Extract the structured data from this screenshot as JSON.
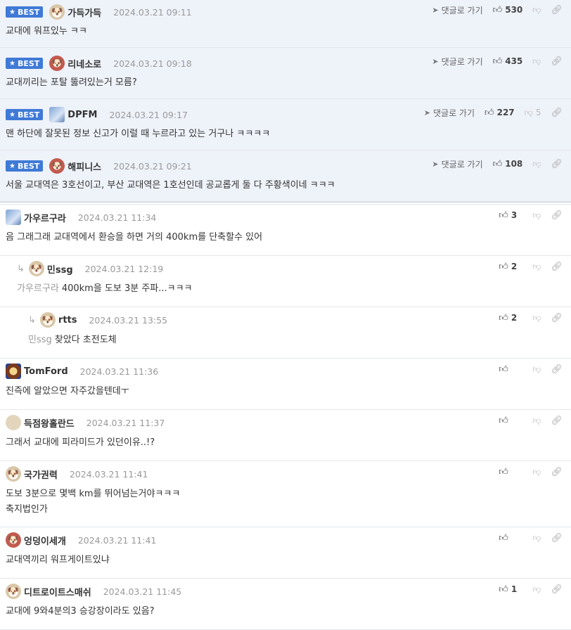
{
  "ui": {
    "best_label": "BEST",
    "goto_label": "댓글로 가기"
  },
  "comments": [
    {
      "nick": "가득가득",
      "date": "2024.03.21 09:11",
      "text": "교대에 워프있누 ㅋㅋ",
      "likes": "530",
      "dislikes": ""
    },
    {
      "nick": "리네소로",
      "date": "2024.03.21 09:18",
      "text": "교대끼리는 포탈 뚫려있는거 모름?",
      "likes": "435",
      "dislikes": ""
    },
    {
      "nick": "DPFM",
      "date": "2024.03.21 09:17",
      "text": "맨 하단에 잘못된 정보 신고가 이럴 때 누르라고 있는 거구나 ㅋㅋㅋㅋ",
      "likes": "227",
      "dislikes": "5"
    },
    {
      "nick": "해피니스",
      "date": "2024.03.21 09:21",
      "text": "서울 교대역은 3호선이고, 부산 교대역은 1호선인데 공교롭게 둘 다 주황색이네 ㅋㅋㅋ",
      "likes": "108",
      "dislikes": ""
    },
    {
      "nick": "가우르구라",
      "date": "2024.03.21 11:34",
      "text": "음 그래그래 교대역에서 환승을 하면 거의 400km를 단축할수 있어",
      "likes": "3",
      "dislikes": ""
    },
    {
      "nick": "민ssg",
      "date": "2024.03.21 12:19",
      "mention": "가우르구라",
      "text": "400km을 도보 3분 주파...ㅋㅋㅋ",
      "likes": "2",
      "dislikes": ""
    },
    {
      "nick": "rtts",
      "date": "2024.03.21 13:55",
      "mention": "민ssg",
      "text": "찾았다 초전도체",
      "likes": "2",
      "dislikes": ""
    },
    {
      "nick": "TomFord",
      "date": "2024.03.21 11:36",
      "text": "진즉에 알았으면 자주갔을텐데ㅜ",
      "likes": "",
      "dislikes": ""
    },
    {
      "nick": "득점왕홀란드",
      "date": "2024.03.21 11:37",
      "text": "그래서 교대에 피라미드가 있던이유..!?",
      "likes": "",
      "dislikes": ""
    },
    {
      "nick": "국가권력",
      "date": "2024.03.21 11:41",
      "text": "도보 3분으로 몇백 km를 뛰어넘는거야ㅋㅋㅋ",
      "text2": "축지법인가",
      "likes": "",
      "dislikes": ""
    },
    {
      "nick": "엉덩이세개",
      "date": "2024.03.21 11:41",
      "text": "교대역끼리 워프게이트있냐",
      "likes": "",
      "dislikes": ""
    },
    {
      "nick": "디트로이트스매쉬",
      "date": "2024.03.21 11:45",
      "text": "교대에 9와4분의3 승강장이라도 있음?",
      "likes": "1",
      "dislikes": ""
    }
  ]
}
